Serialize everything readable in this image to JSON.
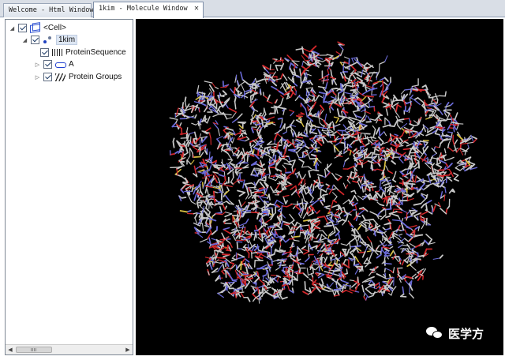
{
  "tabs": [
    {
      "label": "Welcome - Html Window",
      "active": false
    },
    {
      "label": "1kim - Molecule Window",
      "active": true,
      "close": "✕"
    }
  ],
  "tree": {
    "items": [
      {
        "label": "<Cell>",
        "icon": "cube-icon",
        "expanded": true,
        "checked": true
      },
      {
        "label": "1kim",
        "icon": "molecule-icon",
        "expanded": true,
        "checked": true,
        "selected": true
      },
      {
        "label": "ProteinSequence",
        "icon": "sequence-icon",
        "checked": true
      },
      {
        "label": "A",
        "icon": "chain-icon",
        "expanded": false,
        "checked": true
      },
      {
        "label": "Protein Groups",
        "icon": "protein-groups-icon",
        "expanded": false,
        "checked": true
      }
    ]
  },
  "viewer": {
    "background": "#000000",
    "atom_colors": {
      "carbon": "#c8c8c8",
      "nitrogen": "#6b6bd9",
      "oxygen": "#d2262a",
      "sulfur": "#d8c040"
    }
  },
  "watermark": {
    "text": "医学方",
    "icon": "wechat-icon"
  }
}
